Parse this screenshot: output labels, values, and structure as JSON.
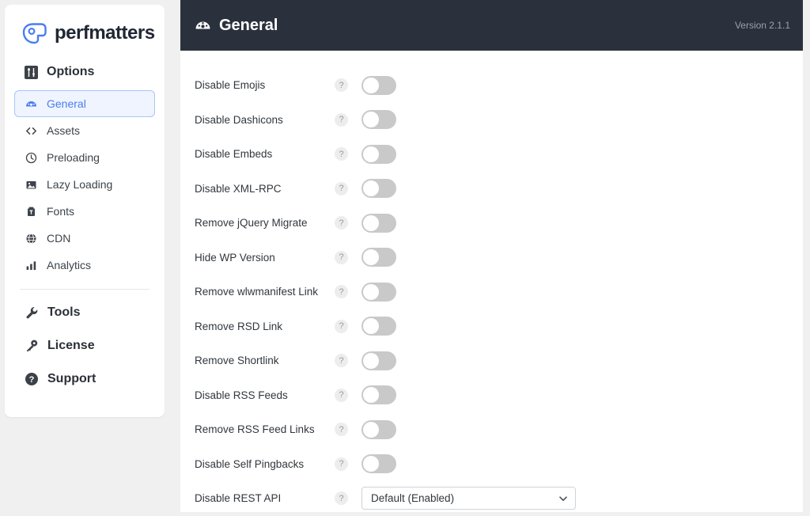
{
  "brand": {
    "name": "perfmatters",
    "logo_icon": "perfmatters-gauge-logo",
    "accent_color": "#4a7df0"
  },
  "sidebar": {
    "section": {
      "label": "Options",
      "icon": "sliders-icon"
    },
    "items": [
      {
        "label": "General",
        "icon": "speedometer-icon",
        "active": true
      },
      {
        "label": "Assets",
        "icon": "code-brackets-icon",
        "active": false
      },
      {
        "label": "Preloading",
        "icon": "clock-icon",
        "active": false
      },
      {
        "label": "Lazy Loading",
        "icon": "image-icon",
        "active": false
      },
      {
        "label": "Fonts",
        "icon": "font-case-icon",
        "active": false
      },
      {
        "label": "CDN",
        "icon": "globe-icon",
        "active": false
      },
      {
        "label": "Analytics",
        "icon": "bar-chart-icon",
        "active": false
      }
    ],
    "secondary_items": [
      {
        "label": "Tools",
        "icon": "wrench-icon"
      },
      {
        "label": "License",
        "icon": "key-icon"
      },
      {
        "label": "Support",
        "icon": "question-circle-icon"
      }
    ]
  },
  "header": {
    "icon": "speedometer-icon",
    "title": "General",
    "version": "Version 2.1.1",
    "background_color": "#2b313c"
  },
  "settings": {
    "help_glyph": "?",
    "rows": [
      {
        "label": "Disable Emojis",
        "control": "toggle",
        "value": "off"
      },
      {
        "label": "Disable Dashicons",
        "control": "toggle",
        "value": "off"
      },
      {
        "label": "Disable Embeds",
        "control": "toggle",
        "value": "off"
      },
      {
        "label": "Disable XML-RPC",
        "control": "toggle",
        "value": "off"
      },
      {
        "label": "Remove jQuery Migrate",
        "control": "toggle",
        "value": "off"
      },
      {
        "label": "Hide WP Version",
        "control": "toggle",
        "value": "off"
      },
      {
        "label": "Remove wlwmanifest Link",
        "control": "toggle",
        "value": "off"
      },
      {
        "label": "Remove RSD Link",
        "control": "toggle",
        "value": "off"
      },
      {
        "label": "Remove Shortlink",
        "control": "toggle",
        "value": "off"
      },
      {
        "label": "Disable RSS Feeds",
        "control": "toggle",
        "value": "off"
      },
      {
        "label": "Remove RSS Feed Links",
        "control": "toggle",
        "value": "off"
      },
      {
        "label": "Disable Self Pingbacks",
        "control": "toggle",
        "value": "off"
      },
      {
        "label": "Disable REST API",
        "control": "select",
        "value": "Default (Enabled)"
      }
    ]
  }
}
